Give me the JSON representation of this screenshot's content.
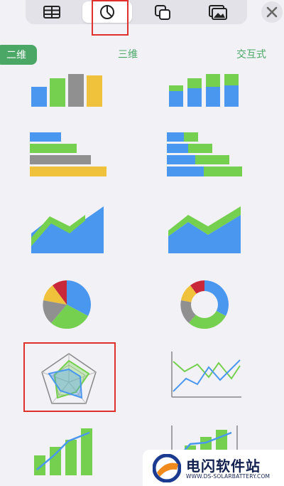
{
  "toolbar": {
    "tabs": [
      {
        "icon": "table-icon"
      },
      {
        "icon": "chart-icon",
        "selected": true
      },
      {
        "icon": "shapes-icon"
      },
      {
        "icon": "media-icon"
      }
    ],
    "close_icon": "close-icon"
  },
  "subtabs": [
    {
      "label": "二维",
      "selected": true
    },
    {
      "label": "三维",
      "selected": false
    },
    {
      "label": "交互式",
      "selected": false
    }
  ],
  "chart_types": [
    "column",
    "stacked-column",
    "bar",
    "stacked-bar",
    "area",
    "stacked-area",
    "pie",
    "donut",
    "radar",
    "line",
    "mixed",
    "two-axis"
  ],
  "colors": {
    "blue": "#4a97f0",
    "green": "#76d04f",
    "gray": "#909090",
    "yellow": "#f0c23c",
    "red": "#c8283a",
    "highlight": "#e0302b",
    "accent": "#4aa765"
  },
  "watermark": {
    "title": "电闪软件站",
    "subtitle": "WWW.DS-SOLARBATTERY.COM"
  }
}
